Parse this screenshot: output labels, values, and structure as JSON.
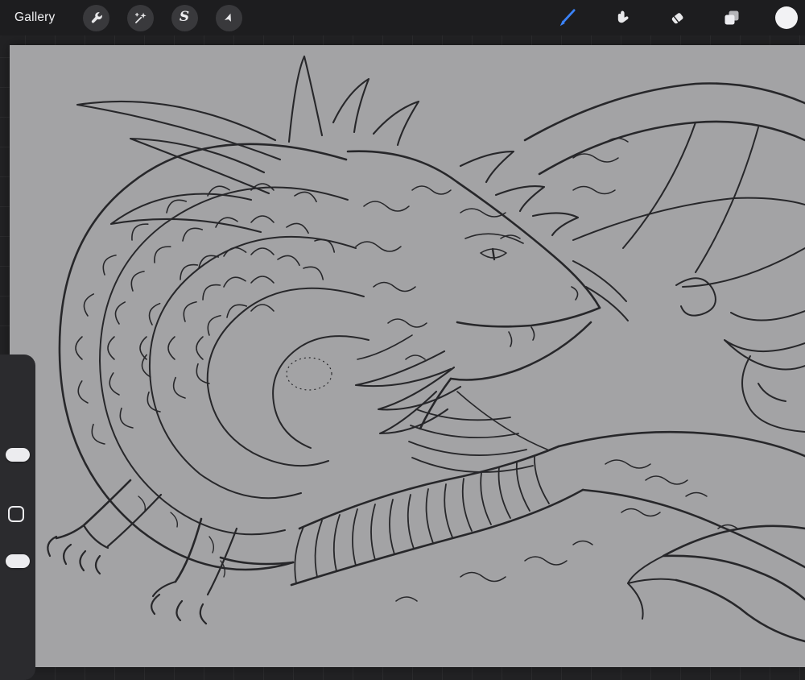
{
  "topbar": {
    "gallery_label": "Gallery",
    "accent_color": "#3b82f7",
    "current_color": "#f2f2f4",
    "selection_glyph": "S",
    "left_tools": [
      {
        "id": "actions",
        "icon": "wrench-icon"
      },
      {
        "id": "adjustments",
        "icon": "magic-wand-icon"
      },
      {
        "id": "selection",
        "icon": "selection-s-icon"
      },
      {
        "id": "transform",
        "icon": "transform-arrow-icon"
      }
    ],
    "right_tools": [
      {
        "id": "paint",
        "icon": "brush-icon",
        "active": true
      },
      {
        "id": "smudge",
        "icon": "smudge-icon"
      },
      {
        "id": "erase",
        "icon": "eraser-icon"
      },
      {
        "id": "layers",
        "icon": "layers-icon"
      },
      {
        "id": "color",
        "icon": "color-swatch-circle"
      }
    ]
  },
  "sidebar": {
    "controls": [
      "brush-size-slider",
      "modify-button",
      "opacity-slider"
    ]
  },
  "canvas": {
    "background_color": "#a3a3a5",
    "workspace_color": "#222224",
    "toolbar_color": "#1d1d1f",
    "line_color": "#27272a",
    "artwork": "Black-and-white line art of a curled dragon: horned head facing right, rings of layered scales on the coiled body, a large membranous wing upper right, ribbed belly band, clawed forelegs lower left and finned tail at lower right"
  }
}
